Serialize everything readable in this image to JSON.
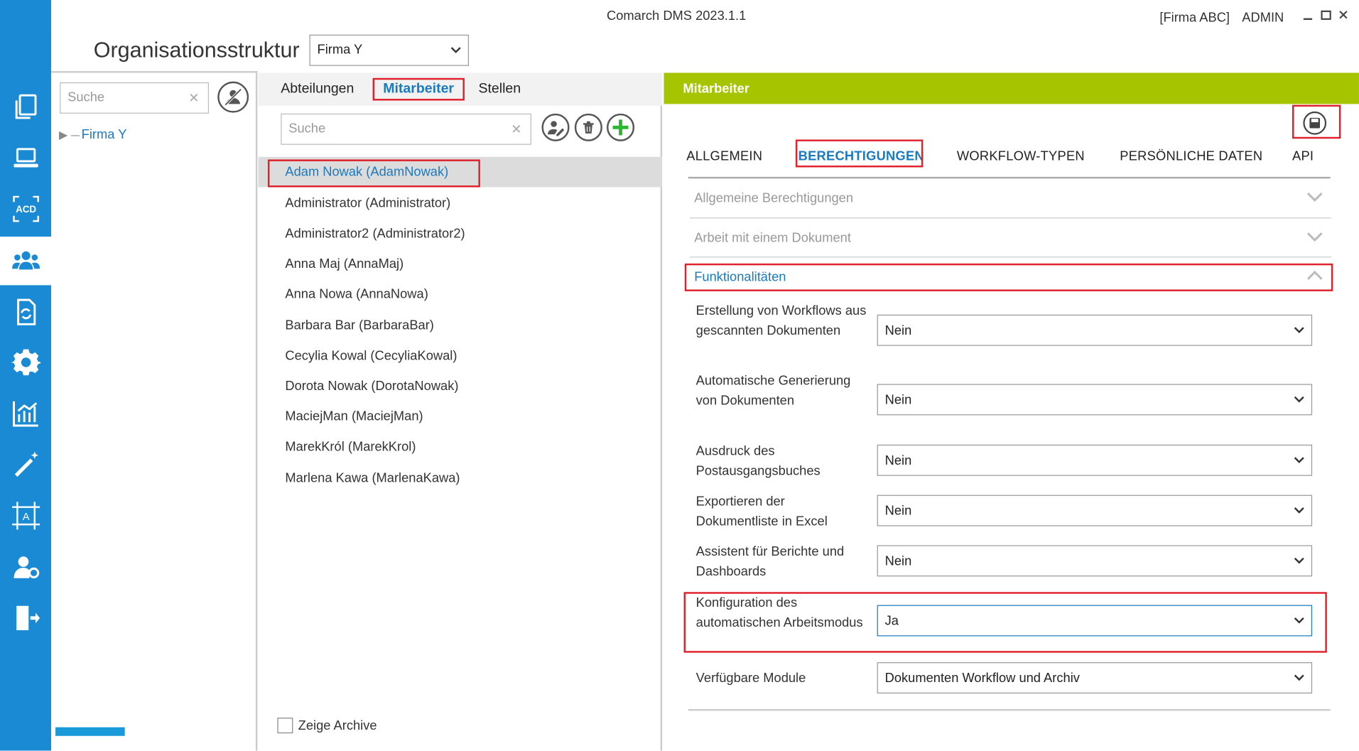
{
  "app": {
    "title": "Comarch DMS 2023.1.1",
    "company_tag": "[Firma ABC]",
    "user": "ADMIN"
  },
  "header": {
    "page_title": "Organisationsstruktur",
    "company_selected": "Firma Y"
  },
  "sidebar": {
    "items": [
      {
        "icon": "documents-icon"
      },
      {
        "icon": "laptop-icon"
      },
      {
        "icon": "acd-icon",
        "label": "ACD"
      },
      {
        "icon": "users-icon",
        "active": true
      },
      {
        "icon": "document-sync-icon"
      },
      {
        "icon": "gear-icon"
      },
      {
        "icon": "chart-icon"
      },
      {
        "icon": "magic-wand-icon"
      },
      {
        "icon": "template-icon"
      },
      {
        "icon": "user-settings-icon"
      },
      {
        "icon": "logout-icon"
      }
    ]
  },
  "left": {
    "search_placeholder": "Suche",
    "tree_root": "Firma Y"
  },
  "middle": {
    "tabs": [
      "Abteilungen",
      "Mitarbeiter",
      "Stellen"
    ],
    "search_placeholder": "Suche",
    "employees": [
      "Adam Nowak (AdamNowak)",
      "Administrator (Administrator)",
      "Administrator2 (Administrator2)",
      "Anna Maj (AnnaMaj)",
      "Anna Nowa (AnnaNowa)",
      "Barbara Bar (BarbaraBar)",
      "Cecylia Kowal (CecyliaKowal)",
      "Dorota Nowak (DorotaNowak)",
      "MaciejMan (MaciejMan)",
      "MarekKról (MarekKrol)",
      "Marlena Kawa (MarlenaKawa)"
    ],
    "archive_label": "Zeige Archive"
  },
  "right": {
    "header": "Mitarbeiter",
    "tabs": [
      "ALLGEMEIN",
      "BERECHTIGUNGEN",
      "WORKFLOW-TYPEN",
      "PERSÖNLICHE DATEN",
      "API"
    ],
    "sections": [
      "Allgemeine Berechtigungen",
      "Arbeit mit einem Dokument",
      "Funktionalitäten"
    ],
    "properties": [
      {
        "label": "Erstellung von Workflows aus gescannten Dokumenten",
        "value": "Nein"
      },
      {
        "label": "Automatische Generierung von Dokumenten",
        "value": "Nein"
      },
      {
        "label": "Ausdruck des Postausgangsbuches",
        "value": "Nein"
      },
      {
        "label": "Exportieren der Dokumentliste in Excel",
        "value": "Nein"
      },
      {
        "label": "Assistent für Berichte und Dashboards",
        "value": "Nein"
      },
      {
        "label": "Konfiguration des automatischen Arbeitsmodus",
        "value": "Ja"
      },
      {
        "label": "Verfügbare Module",
        "value": "Dokumenten Workflow und Archiv"
      }
    ]
  },
  "colors": {
    "sidebar": "#1a8ad4",
    "accent": "#1a7ac0",
    "header_green": "#a6c400",
    "highlight_red": "#e0202a"
  }
}
